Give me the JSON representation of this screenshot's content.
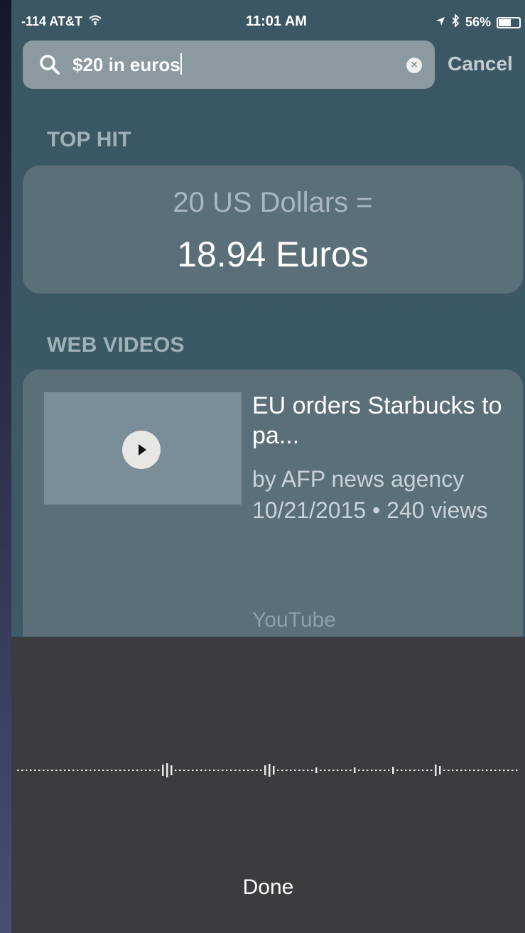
{
  "status_bar": {
    "carrier": "-114 AT&T",
    "time": "11:01 AM",
    "battery": "56%",
    "battery_level": 0.56,
    "icons": [
      "wifi-icon",
      "location-arrow-icon",
      "bluetooth-icon",
      "battery-icon"
    ]
  },
  "search": {
    "query": "$20 in euros",
    "cancel_label": "Cancel"
  },
  "top_hit": {
    "section_label": "TOP HIT",
    "conversion_from": "20 US Dollars =",
    "conversion_to": "18.94 Euros"
  },
  "web_videos": {
    "section_label": "WEB VIDEOS",
    "items": [
      {
        "title": "EU orders Starbucks to pa...",
        "meta": "by AFP news agency 10/21/2015 • 240 views",
        "source": "YouTube"
      }
    ]
  },
  "dictation": {
    "done_label": "Done"
  },
  "colors": {
    "background": "#3b5965",
    "card": "#5b6f79",
    "dictation_panel": "#3b3c40"
  }
}
